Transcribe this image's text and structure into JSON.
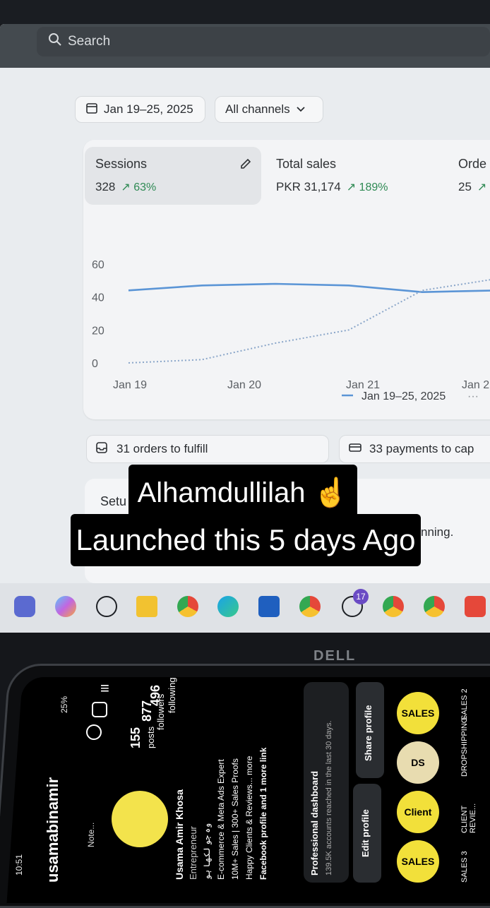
{
  "search": {
    "placeholder": "Search"
  },
  "filters": {
    "date": "Jan 19–25, 2025",
    "channels": "All channels"
  },
  "metrics": [
    {
      "label": "Sessions",
      "value": "328",
      "change": "63%"
    },
    {
      "label": "Total sales",
      "value": "PKR 31,174",
      "change": "189%"
    },
    {
      "label": "Orde",
      "value": "25",
      "change": ""
    }
  ],
  "chart_data": {
    "type": "line",
    "x": [
      "Jan 19",
      "Jan 20",
      "Jan 21",
      "Jan 2"
    ],
    "y_ticks": [
      "60",
      "40",
      "20",
      "0"
    ],
    "ylim": [
      0,
      60
    ],
    "series": [
      {
        "name": "Jan 19–25, 2025",
        "style": "solid",
        "color": "#5b95d6",
        "values": [
          44,
          47,
          48,
          47,
          43,
          44
        ]
      },
      {
        "name": "",
        "style": "dotted",
        "color": "#8aa6c9",
        "values": [
          0,
          2,
          12,
          20,
          44,
          51
        ]
      }
    ],
    "legend": "Jan 19–25, 2025"
  },
  "footer_cards": {
    "orders": "31 orders to fulfill",
    "payments": "33 payments to cap"
  },
  "setup": {
    "partial_title": "Setu",
    "partial_text": "nning."
  },
  "overlay": {
    "line1": "Alhamdullilah ☝",
    "line2": "Launched this 5 days Ago"
  },
  "taskbar": {
    "whatsapp_badge": "17"
  },
  "monitor_brand": "DELL",
  "phone": {
    "status_time": "10:51",
    "battery": "25%",
    "username": "usamabinamir",
    "note": "Note...",
    "stats": [
      {
        "value": "155",
        "label": "posts"
      },
      {
        "value": "877",
        "label": "followers"
      },
      {
        "value": "496",
        "label": "following"
      }
    ],
    "name": "Usama Amir Khosa",
    "role": "Entrepreneur",
    "bio": [
      "وہ جو لکھا ہو",
      "E-commerce & Meta Ads Expert",
      "10M+ Sales | 300+ Sales Proofs",
      "Happy Clients & Reviews... more",
      "Facebook profile and 1 more link"
    ],
    "dashboard_title": "Professional dashboard",
    "dashboard_sub": "139.5K accounts reached in the last 30 days.",
    "buttons": {
      "edit": "Edit profile",
      "share": "Share profile"
    },
    "highlights": [
      {
        "title": "SALES 3",
        "inner": "SALES"
      },
      {
        "title": "CLIENT REVIE...",
        "inner": "Client"
      },
      {
        "title": "DROPSHIPPING",
        "inner": "DS"
      },
      {
        "title": "SALES 2",
        "inner": "SALES"
      }
    ]
  }
}
